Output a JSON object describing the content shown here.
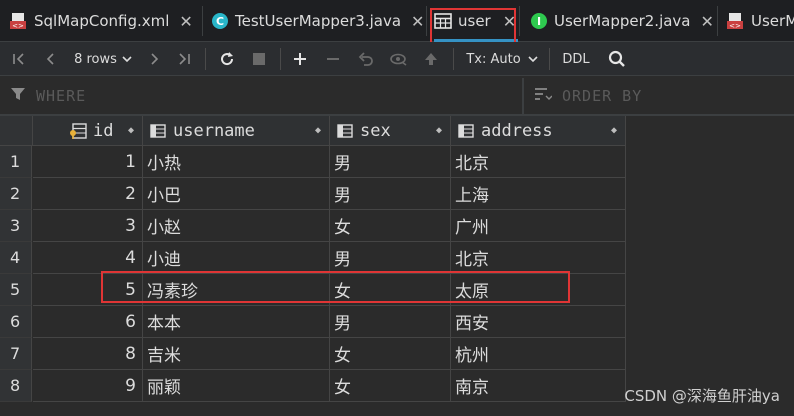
{
  "tabs": [
    {
      "label": "SqlMapConfig.xml",
      "icon": "xml-file-icon",
      "active": false
    },
    {
      "label": "TestUserMapper3.java",
      "icon": "java-class-icon",
      "active": false
    },
    {
      "label": "user",
      "icon": "table-icon",
      "active": true
    },
    {
      "label": "UserMapper2.java",
      "icon": "java-interface-icon",
      "active": false
    },
    {
      "label": "UserM",
      "icon": "xml-file-icon",
      "active": false
    }
  ],
  "toolbar": {
    "rows_label": "8 rows",
    "tx_label": "Tx: Auto",
    "ddl_label": "DDL"
  },
  "filter": {
    "where_placeholder": "WHERE",
    "order_placeholder": "ORDER BY"
  },
  "grid": {
    "columns": [
      "id",
      "username",
      "sex",
      "address"
    ],
    "rows": [
      {
        "num": "1",
        "id": "1",
        "username": "小热",
        "sex": "男",
        "address": "北京"
      },
      {
        "num": "2",
        "id": "2",
        "username": "小巴",
        "sex": "男",
        "address": "上海"
      },
      {
        "num": "3",
        "id": "3",
        "username": "小赵",
        "sex": "女",
        "address": "广州"
      },
      {
        "num": "4",
        "id": "4",
        "username": "小迪",
        "sex": "男",
        "address": "北京"
      },
      {
        "num": "5",
        "id": "5",
        "username": "冯素珍",
        "sex": "女",
        "address": "太原"
      },
      {
        "num": "6",
        "id": "6",
        "username": "本本",
        "sex": "男",
        "address": "西安"
      },
      {
        "num": "7",
        "id": "8",
        "username": "吉米",
        "sex": "女",
        "address": "杭州"
      },
      {
        "num": "8",
        "id": "9",
        "username": "丽颖",
        "sex": "女",
        "address": "南京"
      }
    ]
  },
  "watermark": "CSDN @深海鱼肝油ya",
  "colors": {
    "annotation": "#e03535",
    "active_tab_underline": "#3592c4"
  }
}
